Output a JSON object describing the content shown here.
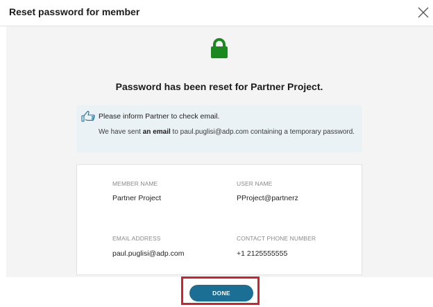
{
  "dialog": {
    "title": "Reset password for member",
    "headline": "Password has been reset for Partner Project.",
    "info": {
      "line1": "Please inform Partner to check email.",
      "line2_prefix": "We have sent ",
      "line2_bold": "an email",
      "line2_suffix": " to paul.puglisi@adp.com containing a temporary password."
    },
    "fields": {
      "member_name_label": "MEMBER NAME",
      "member_name_value": "Partner Project",
      "user_name_label": "USER NAME",
      "user_name_value": "PProject@partnerz",
      "email_label": "EMAIL ADDRESS",
      "email_value": "paul.puglisi@adp.com",
      "phone_label": "CONTACT PHONE NUMBER",
      "phone_value": "+1 2125555555"
    },
    "done_label": "DONE"
  },
  "colors": {
    "lock_green": "#1a8a1f",
    "accent_blue": "#1b6f95",
    "highlight_red": "#d81e2a",
    "info_bg": "#eaf2f6"
  },
  "icons": {
    "close": "close-icon",
    "lock": "lock-icon",
    "info": "pointing-hand-icon"
  }
}
